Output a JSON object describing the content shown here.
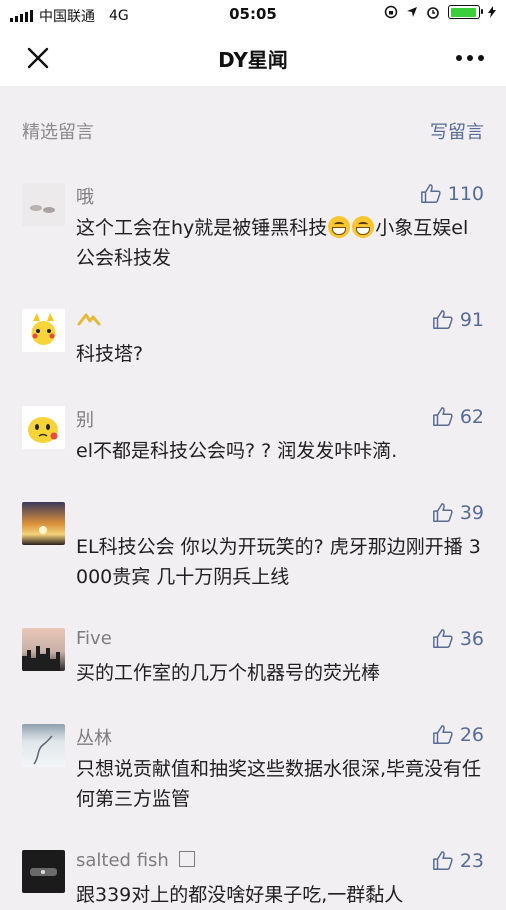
{
  "status_bar": {
    "carrier": "中国联通",
    "network": "4G",
    "time": "05:05"
  },
  "nav": {
    "title": "DY星闻",
    "close_icon": "close-icon",
    "more_icon": "more-icon"
  },
  "section": {
    "title": "精选留言",
    "write_label": "写留言"
  },
  "colors": {
    "link": "#576b95",
    "background": "#f2eff3"
  },
  "comments": [
    {
      "name": "哦",
      "likes": "110",
      "text": [
        "这个工会在hy就是被锤黑科技",
        "小象互娱el公会科技发"
      ],
      "emoji_count": 2
    },
    {
      "name": "",
      "likes": "91",
      "text": [
        "科技塔?"
      ]
    },
    {
      "name": "别",
      "likes": "62",
      "text": [
        "el不都是科技公会吗? ? 润发发咔咔滴."
      ]
    },
    {
      "name": "",
      "likes": "39",
      "text": [
        "EL科技公会 你以为开玩笑的? 虎牙那边刚开播 3000贵宾 几十万阴兵上线"
      ]
    },
    {
      "name": "Five",
      "likes": "36",
      "text": [
        "买的工作室的几万个机器号的荧光棒"
      ]
    },
    {
      "name": "丛林",
      "likes": "26",
      "text": [
        "只想说贡献值和抽奖这些数据水很深,毕竟没有任何第三方监管"
      ]
    },
    {
      "name": "salted fish",
      "likes": "23",
      "text": [
        "跟339对上的都没啥好果子吃,一群黏人"
      ]
    }
  ]
}
